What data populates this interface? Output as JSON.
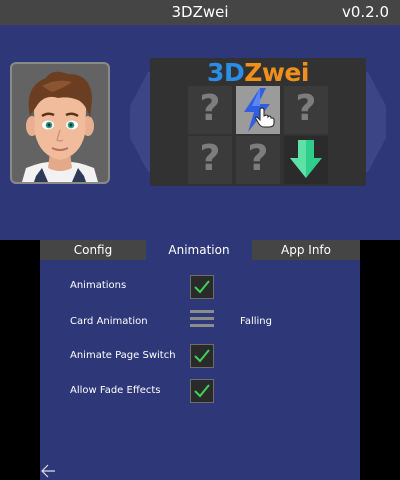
{
  "top": {
    "title": "3DZwei",
    "version": "v0.2.0",
    "logo": {
      "part1": "3D",
      "part2": "Zwei"
    },
    "cards": [
      {
        "face": "?",
        "state": "hidden"
      },
      {
        "face": "lightning-icon",
        "state": "selected"
      },
      {
        "face": "?",
        "state": "hidden"
      },
      {
        "face": "?",
        "state": "hidden"
      },
      {
        "face": "?",
        "state": "hidden"
      },
      {
        "face": "down-arrow-icon",
        "state": "revealed"
      }
    ]
  },
  "bottom": {
    "tabs": [
      "Config",
      "Animation",
      "App Info"
    ],
    "active_tab": "Animation",
    "settings": [
      {
        "label": "Animations",
        "control": "checkbox",
        "checked": true
      },
      {
        "label": "Card Animation",
        "control": "selector",
        "value": "Falling"
      },
      {
        "label": "Animate Page Switch",
        "control": "checkbox",
        "checked": true
      },
      {
        "label": "Allow Fade Effects",
        "control": "checkbox",
        "checked": true
      }
    ]
  },
  "colors": {
    "background": "#2e3778",
    "titlebar": "#454545",
    "logo_blue": "#2a8ee8",
    "logo_orange": "#f0901a",
    "check_green": "#3fd25a",
    "arrow_green": "#2ecf8a"
  }
}
